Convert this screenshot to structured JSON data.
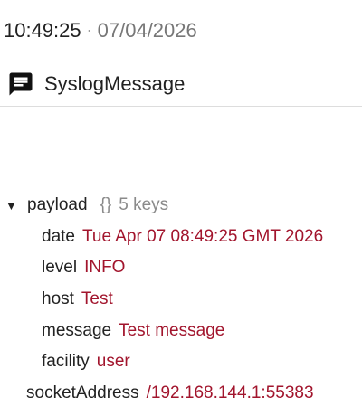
{
  "timestamp": {
    "time": "10:49:25",
    "separator": "·",
    "date": "07/04/2026"
  },
  "message": {
    "icon": "message-icon",
    "type": "SyslogMessage"
  },
  "tree": {
    "payload": {
      "key": "payload",
      "expanded": true,
      "meta_icon": "{}",
      "meta_text": "5 keys",
      "entries": [
        {
          "key": "date",
          "value": "Tue Apr 07 08:49:25 GMT 2026"
        },
        {
          "key": "level",
          "value": "INFO"
        },
        {
          "key": "host",
          "value": "Test"
        },
        {
          "key": "message",
          "value": "Test message"
        },
        {
          "key": "facility",
          "value": "user"
        }
      ]
    },
    "socketAddress": {
      "key": "socketAddress",
      "value": "/192.168.144.1:55383"
    }
  },
  "colors": {
    "value_text": "#a2152d",
    "meta_text": "#8a8a8a",
    "divider": "#dddddd"
  }
}
